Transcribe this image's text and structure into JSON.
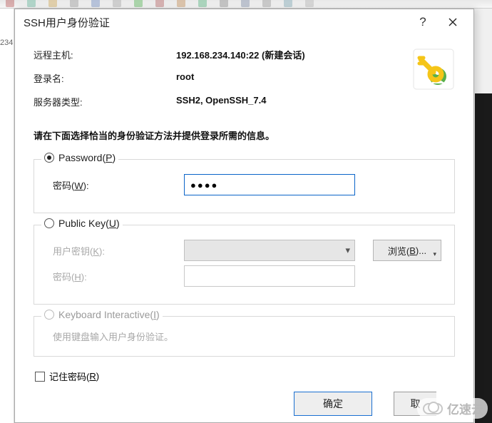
{
  "dialog": {
    "title": "SSH用户身份验证",
    "help_symbol": "?",
    "info": {
      "remote_host_label": "远程主机:",
      "remote_host_value": "192.168.234.140:22 (新建会话)",
      "login_label": "登录名:",
      "login_value": "root",
      "server_type_label": "服务器类型:",
      "server_type_value": "SSH2, OpenSSH_7.4"
    },
    "instruction": "请在下面选择恰当的身份验证方法并提供登录所需的信息。",
    "password_group": {
      "radio_label_pre": "Password(",
      "radio_hotkey": "P",
      "radio_label_post": ")",
      "pwd_label_pre": "密码(",
      "pwd_hotkey": "W",
      "pwd_label_post": "):",
      "pwd_value": "●●●●"
    },
    "pubkey_group": {
      "radio_label_pre": "Public Key(",
      "radio_hotkey": "U",
      "radio_label_post": ")",
      "userkey_label_pre": "用户密钥(",
      "userkey_hotkey": "K",
      "userkey_label_post": "):",
      "browse_pre": "浏览(",
      "browse_hotkey": "B",
      "browse_post": ")...",
      "pwd_label_pre": "密码(",
      "pwd_hotkey": "H",
      "pwd_label_post": "):"
    },
    "kbd_group": {
      "radio_label_pre": "Keyboard Interactive(",
      "radio_hotkey": "I",
      "radio_label_post": ")",
      "desc": "使用键盘输入用户身份验证。"
    },
    "remember": {
      "label_pre": "记住密码(",
      "hotkey": "R",
      "label_post": ")"
    },
    "buttons": {
      "ok": "确定",
      "cancel": "取"
    }
  },
  "bg": {
    "left_text": "234"
  },
  "watermark": {
    "text": "亿速云"
  }
}
